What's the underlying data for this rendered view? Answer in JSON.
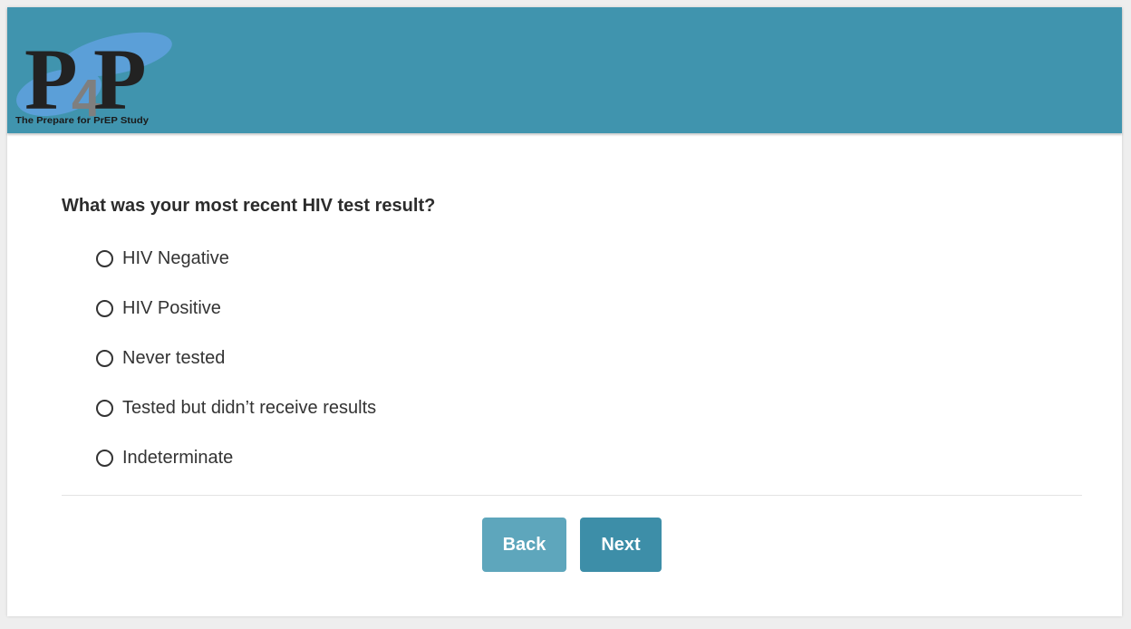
{
  "header": {
    "logo": {
      "mark_letters": [
        "P",
        "4",
        "P"
      ],
      "tagline": "The Prepare for PrEP Study"
    }
  },
  "survey": {
    "question": "What was your most recent HIV test result?",
    "options": [
      {
        "label": "HIV Negative"
      },
      {
        "label": "HIV Positive"
      },
      {
        "label": "Never tested"
      },
      {
        "label": "Tested but didn’t receive results"
      },
      {
        "label": "Indeterminate"
      }
    ]
  },
  "navigation": {
    "back_label": "Back",
    "next_label": "Next"
  },
  "colors": {
    "header_bg": "#4094ae",
    "back_button": "#5ea6bc",
    "next_button": "#3d8ea8",
    "logo_blob": "#5b9fd8"
  }
}
